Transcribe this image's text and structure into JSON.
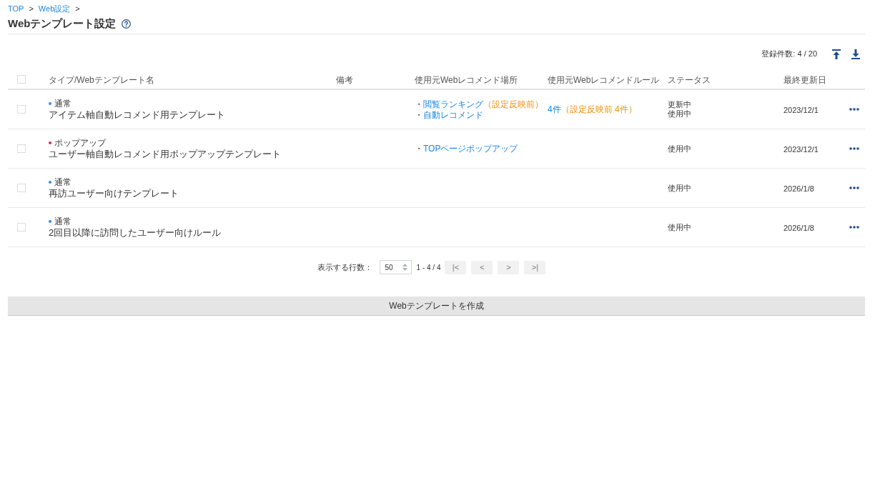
{
  "breadcrumb": [
    {
      "label": "TOP",
      "separator": ">"
    },
    {
      "label": "Web設定",
      "separator": ">"
    }
  ],
  "title": "Webテンプレート設定",
  "toolbar": {
    "count": "登録件数: 4 / 20"
  },
  "table": {
    "select_all": {
      "checked": false
    },
    "columns": [
      "タイプ/Webテンプレート名",
      "備考",
      "使用元Webレコメンド場所",
      "使用元Webレコメンドルール",
      "ステータス",
      "最終更新日"
    ],
    "rows": [
      {
        "checked": false,
        "type": {
          "label": "通常",
          "color": "#2b8ff0"
        },
        "name": "アイテム軸自動レコメンド用テンプレート",
        "places": [
          {
            "bullet": "・",
            "label": "閲覧ランキング",
            "note": "（設定反映前）"
          },
          {
            "bullet": "・",
            "label": "自動レコメンド"
          }
        ],
        "rule": {
          "count": "4件",
          "note": "（設定反映前 4件）"
        },
        "statuses": [
          "更新中",
          "使用中"
        ],
        "updated": "2023/12/1"
      },
      {
        "checked": false,
        "type": {
          "label": "ポップアップ",
          "color": "#e8235a"
        },
        "name": "ユーザー軸自動レコメンド用ポップアップテンプレート",
        "places": [
          {
            "bullet": "・",
            "label": "TOPページポップアップ"
          }
        ],
        "statuses": [
          "使用中"
        ],
        "updated": "2023/12/1"
      },
      {
        "checked": false,
        "type": {
          "label": "通常",
          "color": "#2b8ff0"
        },
        "name": "再訪ユーザー向けテンプレート",
        "statuses": [
          "使用中"
        ],
        "updated": "2026/1/8"
      },
      {
        "checked": false,
        "type": {
          "label": "通常",
          "color": "#2b8ff0"
        },
        "name": "2回目以降に訪問したユーザー向けルール",
        "statuses": [
          "使用中"
        ],
        "updated": "2026/1/8"
      }
    ]
  },
  "pagination": {
    "rows_label": "表示する行数：",
    "rows_per_page": "50",
    "range": "1 - 4 / 4",
    "buttons": [
      {
        "label": "|<",
        "disabled": true
      },
      {
        "label": "<",
        "disabled": true
      },
      {
        "label": ">",
        "disabled": true
      },
      {
        "label": ">|",
        "disabled": true
      }
    ]
  },
  "create_button": "Webテンプレートを作成"
}
